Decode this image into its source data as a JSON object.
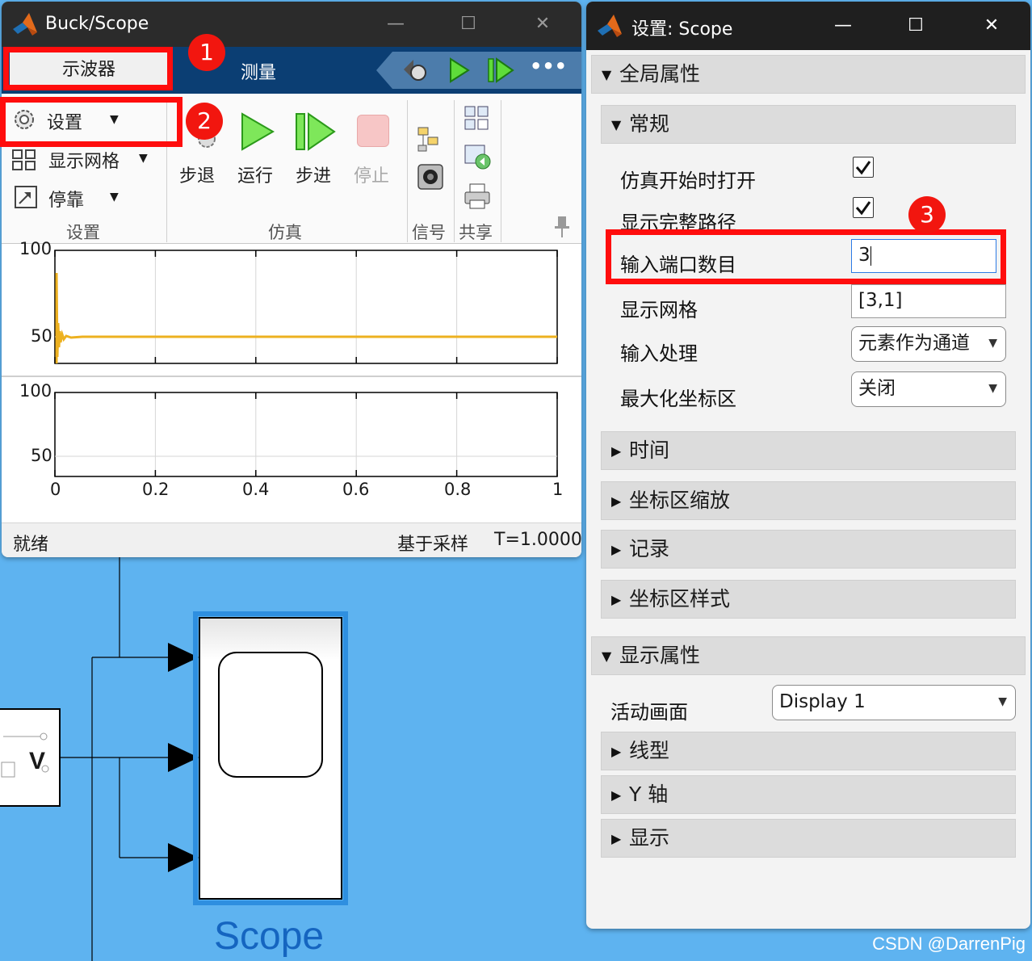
{
  "scope_window": {
    "title": "Buck/Scope",
    "tabs": {
      "active": "示波器",
      "other": "测量"
    },
    "ribbon": {
      "settings_btn": "设置",
      "grid_btn": "显示网格",
      "dock_btn": "停靠",
      "settings_group": "设置",
      "step_back": "步退",
      "run": "运行",
      "step_forward": "步进",
      "stop": "停止",
      "sim_group": "仿真",
      "signal_group": "信号",
      "share_group": "共享"
    },
    "plot1": {
      "y_ticks": [
        "100",
        "50"
      ],
      "line_color": "#edb120"
    },
    "plot2": {
      "y_ticks": [
        "100",
        "50"
      ],
      "x_ticks": [
        "0",
        "0.2",
        "0.4",
        "0.6",
        "0.8",
        "1"
      ]
    },
    "status": {
      "left": "就绪",
      "mode": "基于采样",
      "time": "T=1.0000"
    }
  },
  "settings_window": {
    "title": "设置: Scope",
    "global_section": "全局属性",
    "general_section": "常规",
    "props": {
      "open_at_start": "仿真开始时打开",
      "show_full_path": "显示完整路径",
      "num_inputs_label": "输入端口数目",
      "num_inputs_value": "3",
      "layout_label": "显示网格",
      "layout_value": "[3,1]",
      "input_processing_label": "输入处理",
      "input_processing_value": "元素作为通道",
      "maximize_label": "最大化坐标区",
      "maximize_value": "关闭"
    },
    "collapsed_sections": [
      "时间",
      "坐标区缩放",
      "记录",
      "坐标区样式"
    ],
    "display_section": "显示属性",
    "active_display_label": "活动画面",
    "active_display_value": "Display 1",
    "display_subsections": [
      "线型",
      "Y 轴",
      "显示"
    ]
  },
  "canvas": {
    "block_label": "Scope",
    "voltage_label": "V"
  },
  "annotations": [
    "1",
    "2",
    "3"
  ],
  "watermark": "CSDN @DarrenPig"
}
